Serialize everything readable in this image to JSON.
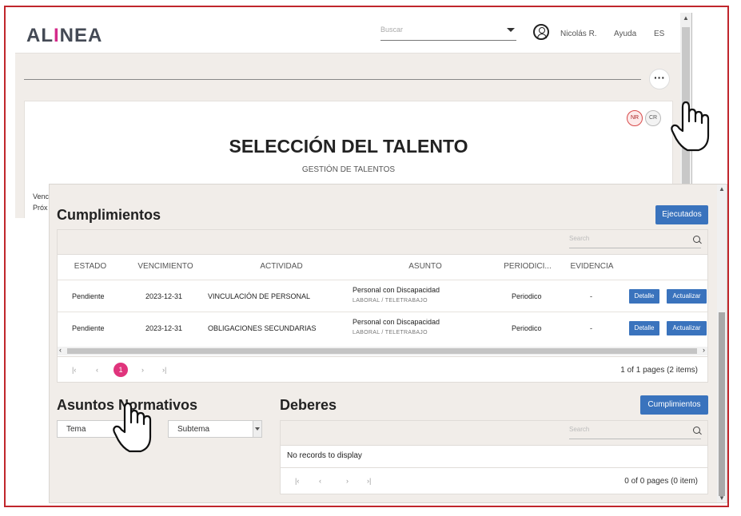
{
  "app": {
    "logo": "ALINEA",
    "search_placeholder": "Buscar",
    "user_name": "Nicolás R.",
    "help": "Ayuda",
    "language": "ES"
  },
  "back_card": {
    "chips": [
      "NR",
      "CR"
    ],
    "title": "SELECCIÓN DEL TALENTO",
    "subtitle": "GESTIÓN DE TALENTOS",
    "clipped_labels": [
      "Venc",
      "Próx"
    ]
  },
  "cumplimientos": {
    "title": "Cumplimientos",
    "executed_button": "Ejecutados",
    "search_placeholder": "Search",
    "columns": [
      "ESTADO",
      "VENCIMIENTO",
      "ACTIVIDAD",
      "ASUNTO",
      "PERIODICI...",
      "EVIDENCIA"
    ],
    "rows": [
      {
        "estado": "Pendiente",
        "vencimiento": "2023-12-31",
        "actividad": "VINCULACIÓN DE PERSONAL",
        "asunto": "Personal con Discapacidad",
        "asunto_sub": "LABORAL / TELETRABAJO",
        "periodicidad": "Periodico",
        "evidencia": "-",
        "detalle": "Detalle",
        "actualizar": "Actualizar"
      },
      {
        "estado": "Pendiente",
        "vencimiento": "2023-12-31",
        "actividad": "OBLIGACIONES SECUNDARIAS",
        "asunto": "Personal con Discapacidad",
        "asunto_sub": "LABORAL / TELETRABAJO",
        "periodicidad": "Periodico",
        "evidencia": "-",
        "detalle": "Detalle",
        "actualizar": "Actualizar"
      }
    ],
    "current_page": "1",
    "page_info": "1 of 1 pages (2 items)"
  },
  "asuntos": {
    "title": "Asuntos Normativos",
    "tema_placeholder": "Tema",
    "subtema_placeholder": "Subtema"
  },
  "deberes": {
    "title": "Deberes",
    "cumplimientos_button": "Cumplimientos",
    "search_placeholder": "Search",
    "empty_text": "No records to display",
    "page_info": "0 of 0 pages (0 item)"
  },
  "colors": {
    "frame": "#c0262c",
    "primary": "#3a73bd",
    "active_page": "#e0347c",
    "background": "#f1ede9"
  }
}
